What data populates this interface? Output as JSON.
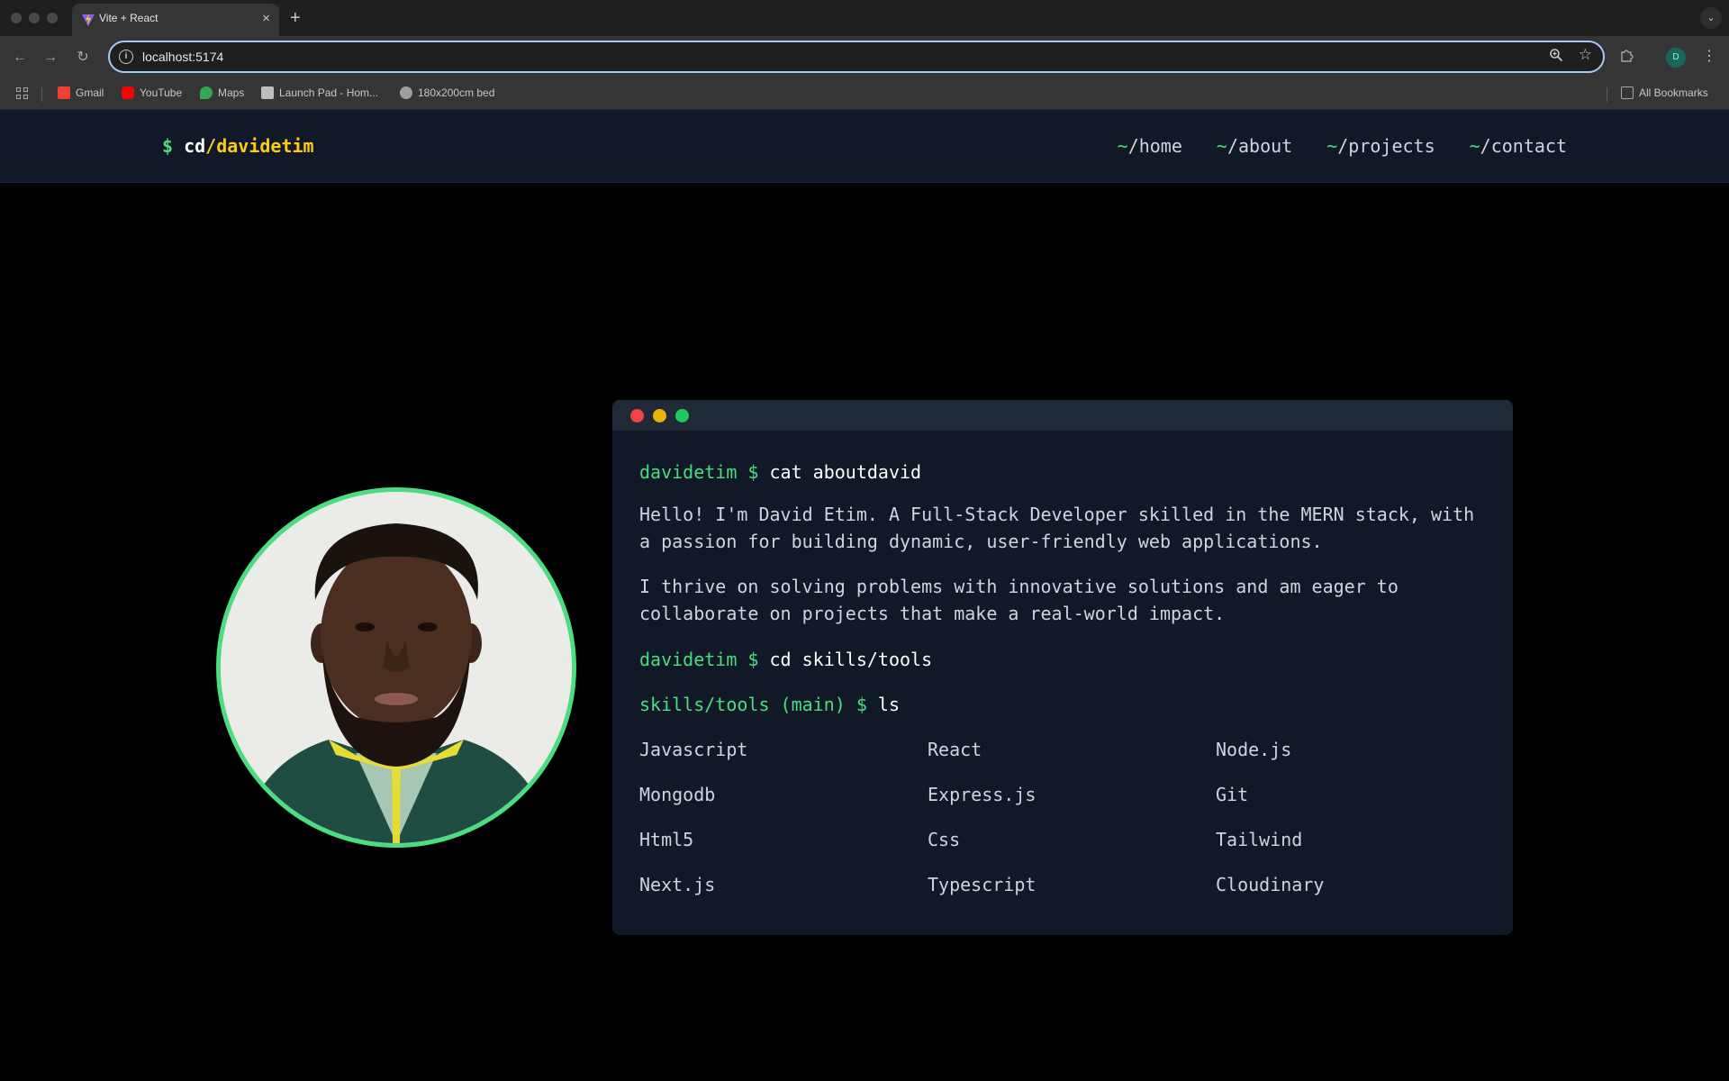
{
  "browser": {
    "tab_title": "Vite + React",
    "tab_close": "×",
    "new_tab": "+",
    "tab_menu": "⌄",
    "url": "localhost:5174",
    "profile_initial": "D",
    "bookmarks": [
      {
        "label": "Gmail",
        "icon": "gmail-icon",
        "color": "#ea4335"
      },
      {
        "label": "YouTube",
        "icon": "youtube-icon",
        "color": "#ff0000"
      },
      {
        "label": "Maps",
        "icon": "maps-icon",
        "color": "#34a853"
      },
      {
        "label": "Launch Pad - Hom...",
        "icon": "launchpad-icon",
        "color": "#bdbdbd"
      },
      {
        "label": "180x200cm bed",
        "icon": "globe-icon",
        "color": "#9e9e9e"
      }
    ],
    "all_bookmarks": "All Bookmarks"
  },
  "site": {
    "brand": {
      "dollar": "$",
      "cd": " cd",
      "path": "/davidetim"
    },
    "nav": [
      {
        "tilde": "~",
        "label": "/home"
      },
      {
        "tilde": "~",
        "label": "/about"
      },
      {
        "tilde": "~",
        "label": "/projects"
      },
      {
        "tilde": "~",
        "label": "/contact"
      }
    ]
  },
  "terminal": {
    "line1": {
      "prompt": "davidetim $",
      "cmd": " cat aboutdavid"
    },
    "para1": "Hello! I'm David Etim. A Full-Stack Developer skilled in the MERN stack, with a passion for building dynamic, user-friendly web applications.",
    "para2": "I thrive on solving problems with innovative solutions and am eager to collaborate on projects that make a real-world impact.",
    "line2": {
      "prompt": "davidetim $",
      "cmd": " cd skills/tools"
    },
    "line3": {
      "prompt": "skills/tools (main) $",
      "cmd": " ls"
    },
    "skills": [
      "Javascript",
      "React",
      "Node.js",
      "Mongodb",
      "Express.js",
      "Git",
      "Html5",
      "Css",
      "Tailwind",
      "Next.js",
      "Typescript",
      "Cloudinary"
    ]
  },
  "colors": {
    "accent_green": "#4ade80",
    "accent_yellow": "#facc15",
    "nav_bg": "#111827",
    "dot_red": "#ef4444",
    "dot_yellow": "#eab308",
    "dot_green": "#22c55e"
  }
}
